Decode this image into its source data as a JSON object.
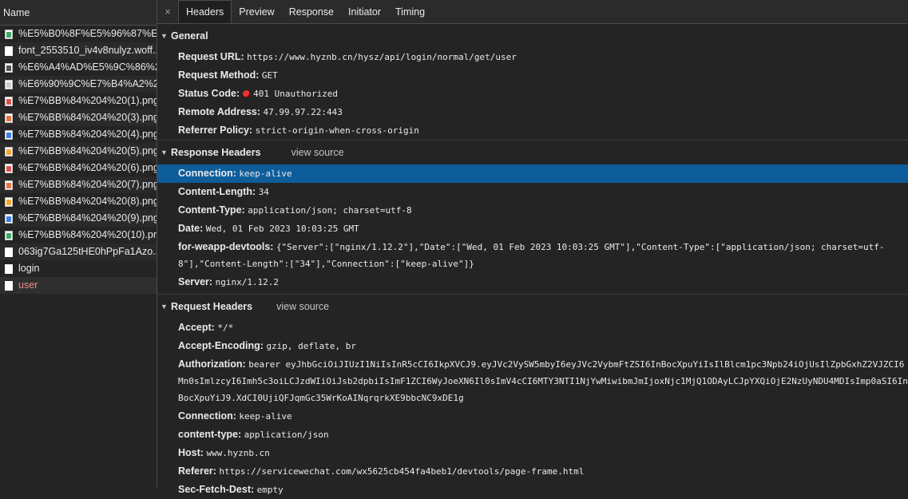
{
  "left": {
    "header": "Name",
    "requests": [
      {
        "name": "%E5%B0%8F%E5%96%87%E5...",
        "icon": "image",
        "color": "#3da862"
      },
      {
        "name": "font_2553510_iv4v8nulyz.woff...",
        "icon": "document",
        "color": "#ffffff"
      },
      {
        "name": "%E6%A4%AD%E5%9C%86%2...",
        "icon": "image",
        "color": "#555555"
      },
      {
        "name": "%E6%90%9C%E7%B4%A2%20...",
        "icon": "image",
        "color": "#cccccc"
      },
      {
        "name": "%E7%BB%84%204%20(1).png",
        "icon": "image",
        "color": "#d9534f"
      },
      {
        "name": "%E7%BB%84%204%20(3).png",
        "icon": "image",
        "color": "#e8743b"
      },
      {
        "name": "%E7%BB%84%204%20(4).png",
        "icon": "image",
        "color": "#3b7de8"
      },
      {
        "name": "%E7%BB%84%204%20(5).png",
        "icon": "image",
        "color": "#f0a830"
      },
      {
        "name": "%E7%BB%84%204%20(6).png",
        "icon": "image",
        "color": "#d9534f"
      },
      {
        "name": "%E7%BB%84%204%20(7).png",
        "icon": "image",
        "color": "#e8743b"
      },
      {
        "name": "%E7%BB%84%204%20(8).png",
        "icon": "image",
        "color": "#f0a830"
      },
      {
        "name": "%E7%BB%84%204%20(9).png",
        "icon": "image",
        "color": "#3b7de8"
      },
      {
        "name": "%E7%BB%84%204%20(10).png",
        "icon": "image",
        "color": "#3da862"
      },
      {
        "name": "063ig7Ga125tHE0hPpFa1Azo...",
        "icon": "document",
        "color": "#ffffff"
      },
      {
        "name": "login",
        "icon": "document",
        "color": "#ffffff"
      },
      {
        "name": "user",
        "icon": "document",
        "color": "#ffffff",
        "selected": true
      }
    ]
  },
  "tabs": {
    "close": "×",
    "items": [
      "Headers",
      "Preview",
      "Response",
      "Initiator",
      "Timing"
    ],
    "active": "Headers"
  },
  "general": {
    "title": "General",
    "rows": [
      {
        "key": "Request URL:",
        "value": "https://www.hyznb.cn/hysz/api/login/normal/get/user"
      },
      {
        "key": "Request Method:",
        "value": "GET"
      },
      {
        "key": "Status Code:",
        "value": "401 Unauthorized"
      },
      {
        "key": "Remote Address:",
        "value": "47.99.97.22:443"
      },
      {
        "key": "Referrer Policy:",
        "value": "strict-origin-when-cross-origin"
      }
    ]
  },
  "response_headers": {
    "title": "Response Headers",
    "view_source": "view source",
    "rows": [
      {
        "key": "Connection:",
        "value": "keep-alive"
      },
      {
        "key": "Content-Length:",
        "value": "34"
      },
      {
        "key": "Content-Type:",
        "value": "application/json; charset=utf-8"
      },
      {
        "key": "Date:",
        "value": "Wed, 01 Feb 2023 10:03:25 GMT"
      },
      {
        "key": "for-weapp-devtools:",
        "value": "{\"Server\":[\"nginx/1.12.2\"],\"Date\":[\"Wed, 01 Feb 2023 10:03:25 GMT\"],\"Content-Type\":[\"application/json; charset=utf-8\"],\"Content-Length\":[\"34\"],\"Connection\":[\"keep-alive\"]}"
      },
      {
        "key": "Server:",
        "value": "nginx/1.12.2"
      }
    ]
  },
  "request_headers": {
    "title": "Request Headers",
    "view_source": "view source",
    "rows": [
      {
        "key": "Accept:",
        "value": "*/*"
      },
      {
        "key": "Accept-Encoding:",
        "value": "gzip, deflate, br"
      },
      {
        "key": "Authorization:",
        "value": "bearer eyJhbGciOiJIUzI1NiIsInR5cCI6IkpXVCJ9.eyJVc2VySW5mbyI6eyJVc2VybmFtZSI6InBocXpuYiIsIlBlcm1pc3Npb24iOjUsIlZpbGxhZ2VJZCI6Mn0sImlzcyI6Imh5c3oiLCJzdWIiOiJsb2dpbiIsImF1ZCI6WyJoeXN6Il0sImV4cCI6MTY3NTI1NjYwMiwibmJmIjoxNjc1MjQ1ODAyLCJpYXQiOjE2NzUyNDU4MDIsImp0aSI6InBocXpuYiJ9.XdCI0UjiQFJqmGc35WrKoAINqrqrkXE9bbcNC9xDE1g"
      },
      {
        "key": "Connection:",
        "value": "keep-alive"
      },
      {
        "key": "content-type:",
        "value": "application/json"
      },
      {
        "key": "Host:",
        "value": "www.hyznb.cn"
      },
      {
        "key": "Referer:",
        "value": "https://servicewechat.com/wx5625cb454fa4beb1/devtools/page-frame.html"
      },
      {
        "key": "Sec-Fetch-Dest:",
        "value": "empty"
      }
    ]
  }
}
